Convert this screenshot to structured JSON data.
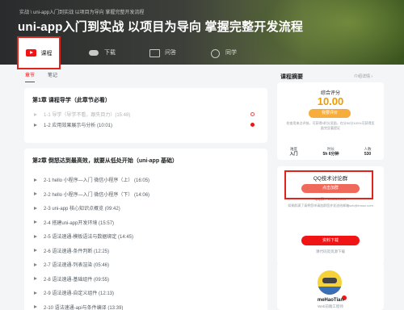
{
  "breadcrumb": "实战 \\ uni-app入门到实战 以项目为导向 掌握完整开发流程",
  "title": "uni-app入门到实战 以项目为导向 掌握完整开发流程",
  "tabs": [
    {
      "label": "课程",
      "icon": "course-icon",
      "active": true
    },
    {
      "label": "下载",
      "icon": "download-icon"
    },
    {
      "label": "问答",
      "icon": "qa-icon"
    },
    {
      "label": "同学",
      "icon": "classmates-icon"
    }
  ],
  "subtabs": [
    "章节",
    "笔记"
  ],
  "chapters": [
    {
      "title": "第1章 课程导学（此章节必看）",
      "lessons": [
        {
          "label": "1-1 导学（导学不看，跟失目力）(15:48)",
          "viewing": true
        },
        {
          "label": "1-2 应用效果展示与分析 (10:01)",
          "viewing": false
        }
      ]
    },
    {
      "title": "第2章 倒怒达到最高效，就要从低处开始（uni-app 基础）",
      "lessons": [
        {
          "label": "2-1 hello 小程序—入门 微信小程序（上） (16:05)"
        },
        {
          "label": "2-2 hello 小程序—入门 微信小程序（下） (14:06)"
        },
        {
          "label": "2-3 uni-app 核心知识点概览 (09:42)"
        },
        {
          "label": "2-4 搭建uni-app开发环境 (15:57)"
        },
        {
          "label": "2-5 语法速通-模板语法与数据绑定 (14:45)"
        },
        {
          "label": "2-6 语法速通-条件判断 (12:25)"
        },
        {
          "label": "2-7 语法速通-列表渲染 (05:46)"
        },
        {
          "label": "2-8 语法速通-基础组件 (09:55)"
        },
        {
          "label": "2-9 语法速通-自定义组件 (12:13)"
        },
        {
          "label": "2-10 语法速通-api与条件编译 (13:39)"
        }
      ]
    }
  ],
  "sidebar": {
    "title": "课程摘要",
    "link": "介绍详情 ›",
    "score_label": "综合评分",
    "score": "10.00",
    "rate_button": "我要评价",
    "rate_note": "检查用来点评前，可获得5积分奖励，在分50分100%可获得奖励完显著提证",
    "stats": [
      {
        "label": "难度",
        "value": "入门"
      },
      {
        "label": "时长",
        "value": "5h 6分钟"
      },
      {
        "label": "人数",
        "value": "530"
      }
    ],
    "qq_title": "QQ技术讨论群",
    "qq_join": "点击加群",
    "qq_number": "QQ群：965123013",
    "qq_note": "如果群满了请将您申请加群您并发送给邮箱szh@imooc.com",
    "material_button": "资料下载",
    "material_note": "课代码及资源下载",
    "teacher_name": "meHaoTian",
    "teacher_role": "Web前端工程师"
  }
}
